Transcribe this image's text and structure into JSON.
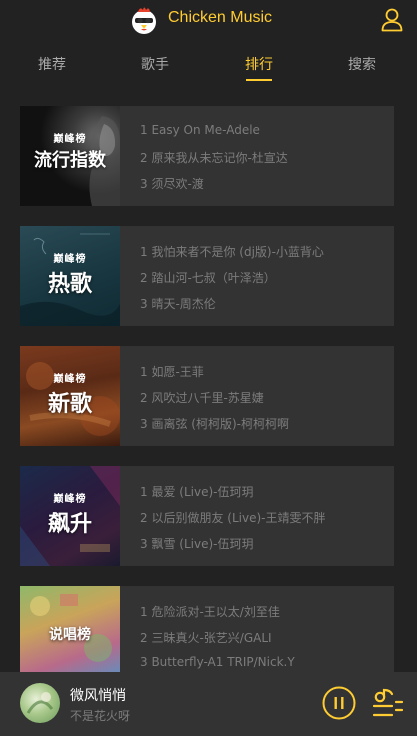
{
  "header": {
    "title": "Chicken Music",
    "logo_icon": "chicken-logo-icon",
    "user_icon": "user-icon",
    "accent_color": "#ffcd32"
  },
  "tabs": [
    {
      "label": "推荐",
      "active": false
    },
    {
      "label": "歌手",
      "active": false
    },
    {
      "label": "排行",
      "active": true
    },
    {
      "label": "搜索",
      "active": false
    }
  ],
  "ranks": [
    {
      "badge": "巅峰榜",
      "cover_title": "流行指数",
      "songs": [
        "1 Easy On Me-Adele",
        "2 原来我从未忘记你-杜宣达",
        "3 须尽欢-渡"
      ]
    },
    {
      "badge": "巅峰榜",
      "cover_title": "热歌",
      "songs": [
        "1 我怕来者不是你 (dj版)-小蓝背心",
        "2 踏山河-七叔（叶泽浩）",
        "3 晴天-周杰伦"
      ]
    },
    {
      "badge": "巅峰榜",
      "cover_title": "新歌",
      "songs": [
        "1 如愿-王菲",
        "2 风吹过八千里-苏星婕",
        "3 画离弦 (柯柯版)-柯柯柯啊"
      ]
    },
    {
      "badge": "巅峰榜",
      "cover_title": "飙升",
      "songs": [
        "1 最爱 (Live)-伍珂玥",
        "2 以后别做朋友 (Live)-王靖雯不胖",
        "3 飘雪 (Live)-伍珂玥"
      ]
    },
    {
      "badge": "",
      "cover_title": "说唱榜",
      "songs": [
        "1 危险派对-王以太/刘至佳",
        "2 三昧真火-张艺兴/GALI",
        "3 Butterfly-A1 TRIP/Nick.Y"
      ]
    }
  ],
  "mini_player": {
    "song_name": "微风悄悄",
    "singer": "不是花火呀",
    "play_icon": "pause-icon",
    "playlist_icon": "playlist-icon"
  }
}
